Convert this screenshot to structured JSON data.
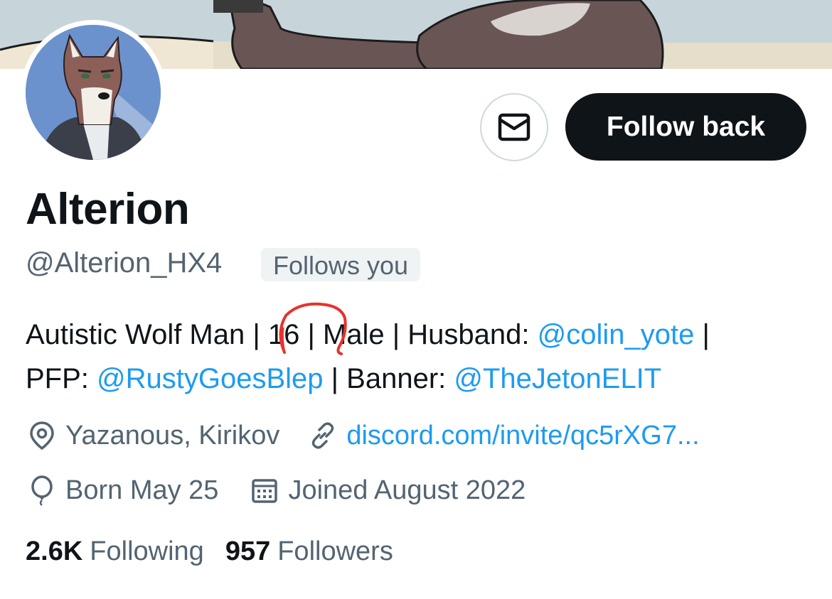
{
  "profile": {
    "display_name": "Alterion",
    "handle": "@Alterion_HX4",
    "follows_you_badge": "Follows you",
    "follow_button_label": "Follow back"
  },
  "bio": {
    "line1_text1": "Autistic Wolf Man | 16 | Male | Husband: ",
    "line1_mention": "@colin_yote",
    "line1_text2": " |",
    "line2_text1": "PFP: ",
    "line2_mention1": "@RustyGoesBlep",
    "line2_text2": " | Banner: ",
    "line2_mention2": "@TheJetonELIT"
  },
  "meta": {
    "location": "Yazanous, Kirikov",
    "website": "discord.com/invite/qc5rXG7...",
    "birthday": "Born May 25",
    "joined": "Joined August 2022"
  },
  "stats": {
    "following_count": "2.6K",
    "following_label": "Following",
    "followers_count": "957",
    "followers_label": "Followers"
  },
  "icons": {
    "message": "envelope-icon",
    "location": "location-pin-icon",
    "website": "link-icon",
    "birthday": "balloon-icon",
    "joined": "calendar-icon"
  },
  "colors": {
    "accent": "#1d9bf0",
    "text_primary": "#0f1419",
    "text_secondary": "#536471",
    "annotation": "#e8322c"
  }
}
